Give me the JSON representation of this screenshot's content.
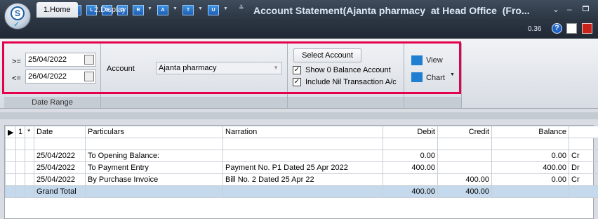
{
  "window": {
    "title": "Account Statement(Ajanta pharmacy  at Head Office  (Fro...",
    "logo_letter": "S",
    "quick_access": [
      "P",
      "N",
      "V",
      "L",
      "G",
      "O",
      "R",
      "A",
      "T",
      "U"
    ],
    "controls": [
      "menu",
      "minimize",
      "restore",
      "close"
    ]
  },
  "tabs": [
    {
      "label": "1.Home",
      "active": true
    },
    {
      "label": "2.Display",
      "active": false
    }
  ],
  "status": {
    "version": "0.36"
  },
  "ribbon": {
    "date_range": {
      "caption": "Date Range",
      "from_label": ">=",
      "from_value": "25/04/2022",
      "to_label": "<=",
      "to_value": "26/04/2022"
    },
    "account": {
      "label": "Account",
      "value": "Ajanta pharmacy"
    },
    "options": {
      "select_account_label": "Select Account",
      "show_zero_label": "Show 0 Balance Account",
      "show_zero_checked": true,
      "include_nil_label": "Include Nil Transaction A/c",
      "include_nil_checked": true
    },
    "actions": {
      "view_label": "View",
      "chart_label": "Chart"
    }
  },
  "table": {
    "columns": [
      "",
      "1",
      "*",
      "Date",
      "Particulars",
      "Narration",
      "Debit",
      "Credit",
      "Balance",
      ""
    ],
    "rows": [
      {
        "date": "25/04/2022",
        "particulars": "To Opening Balance:",
        "narration": "",
        "debit": "0.00",
        "credit": "",
        "balance": "0.00",
        "drcr": "Cr"
      },
      {
        "date": "25/04/2022",
        "particulars": "To Payment Entry",
        "narration": "Payment No. P1 Dated 25 Apr 2022",
        "debit": "400.00",
        "credit": "",
        "balance": "400.00",
        "drcr": "Dr"
      },
      {
        "date": "25/04/2022",
        "particulars": "By Purchase Invoice",
        "narration": "Bill No. 2 Dated 25 Apr 22",
        "debit": "",
        "credit": "400.00",
        "balance": "0.00",
        "drcr": "Cr"
      }
    ],
    "total": {
      "label": "Grand Total",
      "debit": "400.00",
      "credit": "400.00"
    }
  },
  "colors": {
    "highlight": "#e4004b",
    "titlebar": "#2f3a48",
    "total_row": "#c5d9ec"
  }
}
